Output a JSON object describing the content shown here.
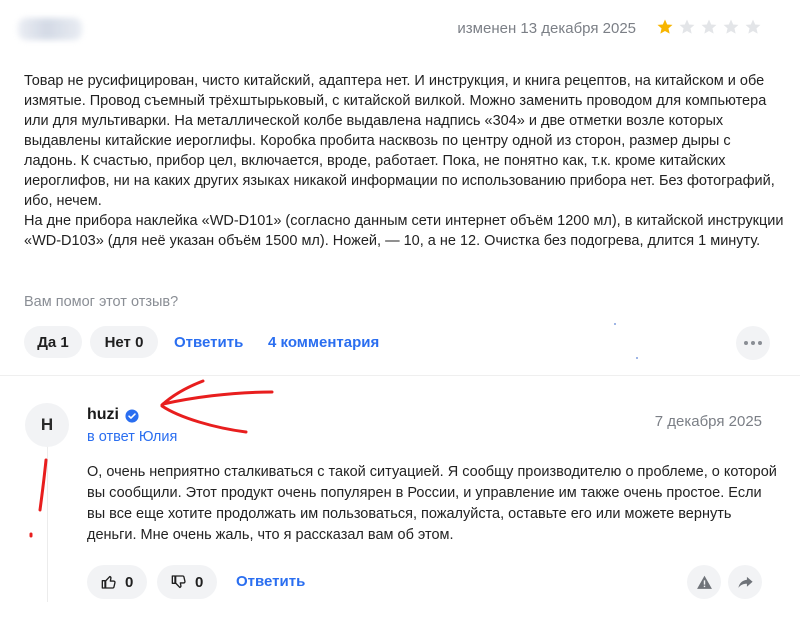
{
  "review": {
    "changed_date": "изменен 13 декабря 2025",
    "rating": 1,
    "rating_max": 5,
    "star_filled_color": "#f7b500",
    "star_empty_color": "#e3e5e8",
    "text_lines": [
      "Товар не русифицирован, чисто китайский, адаптера нет. И инструкция, и книга рецептов, на китайском и обе измятые. Провод съемный трёхштырьковый, с китайской вилкой. Можно заменить проводом для компьютера или для мультиварки. На металлической колбе выдавлена надпись «304» и две отметки возле которых выдавлены китайские иероглифы. Коробка пробита насквозь по центру одной из сторон, размер дыры с ладонь. К счастью, прибор цел, включается, вроде, работает. Пока, не понятно как, т.к. кроме китайских иероглифов, ни на каких других языках никакой информации по использованию прибора нет. Без фотографий, ибо, нечем.",
      "На дне прибора наклейка «WD-D101» (согласно данным сети интернет объём 1200 мл), в китайской инструкции «WD-D103» (для неё указан объём 1500 мл). Ножей, — 10, а не 12. Очистка без подогрева, длится 1 минуту."
    ]
  },
  "feedback": {
    "question": "Вам помог этот отзыв?",
    "yes_label": "Да 1",
    "no_label": "Нет 0",
    "reply_label": "Ответить",
    "comments_label": "4 комментария",
    "more_icon": "more-dots-icon"
  },
  "reply": {
    "avatar_letter": "H",
    "author": "huzi",
    "verified_icon": "verified-check-icon",
    "in_reply_to": "в ответ Юлия",
    "date": "7 декабря 2025",
    "text": "О, очень неприятно сталкиваться с такой ситуацией. Я сообщу производителю о проблеме, о которой вы сообщили. Этот продукт очень популярен в России, и управление им также очень простое. Если вы все еще хотите продолжать им пользоваться, пожалуйста, оставьте его или можете вернуть деньги. Мне очень жаль, что я рассказал вам об этом.",
    "likes": "0",
    "dislikes": "0",
    "reply_label": "Ответить",
    "like_icon": "thumbs-up-icon",
    "dislike_icon": "thumbs-down-icon",
    "report_icon": "warning-icon",
    "share_icon": "share-arrow-icon"
  },
  "colors": {
    "link": "#2a6ef0",
    "annotation": "#e81e1e"
  }
}
